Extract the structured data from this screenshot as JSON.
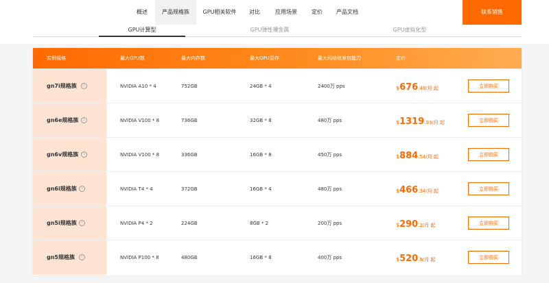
{
  "nav": {
    "items": [
      "概述",
      "产品规格族",
      "GPU相关软件",
      "对比",
      "应用场景",
      "定价",
      "产品文档"
    ],
    "active_index": 1,
    "contact_label": "联系销售"
  },
  "tabs": {
    "items": [
      "GPU计算型",
      "GPU弹性裸金属",
      "GPU虚拟化型"
    ],
    "active_index": 0
  },
  "table": {
    "headers": [
      "实例规格",
      "最大GPU数",
      "最大内存数",
      "最大GPU显存",
      "最大网络收发包能力",
      "定价"
    ],
    "rows": [
      {
        "name": "gn7i规格族",
        "gpu": "NVIDIA A10 * 4",
        "memory": "752GB",
        "gpu_mem": "24GB * 4",
        "pps": "2400万 pps",
        "currency": "$",
        "price_int": "676",
        "price_dec": ".49",
        "price_unit": "/月 起",
        "buy_label": "立即购买"
      },
      {
        "name": "gn6e规格族",
        "gpu": "NVIDIA V100 * 8",
        "memory": "736GB",
        "gpu_mem": "32GB * 8",
        "pps": "480万 pps",
        "currency": "$",
        "price_int": "1319",
        "price_dec": ".93",
        "price_unit": "/月 起",
        "buy_label": "立即购买"
      },
      {
        "name": "gn6v规格族",
        "gpu": "NVIDIA V100 * 8",
        "memory": "336GB",
        "gpu_mem": "16GB * 8",
        "pps": "450万 pps",
        "currency": "$",
        "price_int": "884",
        "price_dec": ".54",
        "price_unit": "/月 起",
        "buy_label": "立即购买"
      },
      {
        "name": "gn6i规格族",
        "gpu": "NVIDIA T4 * 4",
        "memory": "372GB",
        "gpu_mem": "16GB * 4",
        "pps": "480万 pps",
        "currency": "$",
        "price_int": "466",
        "price_dec": ".34",
        "price_unit": "/月 起",
        "buy_label": "立即购买"
      },
      {
        "name": "gn5i规格族",
        "gpu": "NVIDIA P4 * 2",
        "memory": "224GB",
        "gpu_mem": "8GB * 2",
        "pps": "200万 pps",
        "currency": "$",
        "price_int": "290",
        "price_dec": ".2",
        "price_unit": "/月 起",
        "buy_label": "立即购买"
      },
      {
        "name": "gn5规格族",
        "gpu": "NVIDIA P100 * 8",
        "memory": "480GB",
        "gpu_mem": "16GB * 8",
        "pps": "400万 pps",
        "currency": "$",
        "price_int": "520",
        "price_dec": ".9",
        "price_unit": "/月 起",
        "buy_label": "立即购买"
      }
    ]
  },
  "colors": {
    "accent": "#ff6a00",
    "name_cell_bg": "#fde4d2"
  }
}
